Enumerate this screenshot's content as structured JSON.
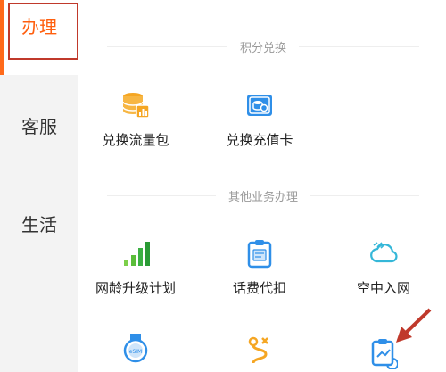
{
  "sidebar": {
    "items": [
      {
        "label": "办理",
        "active": true
      },
      {
        "label": "客服",
        "active": false
      },
      {
        "label": "生活",
        "active": false
      }
    ]
  },
  "sections": [
    {
      "title": "积分兑换",
      "tiles": [
        {
          "label": "兑换流量包",
          "icon": "data-package-icon"
        },
        {
          "label": "兑换充值卡",
          "icon": "recharge-card-icon"
        }
      ]
    },
    {
      "title": "其他业务办理",
      "tiles": [
        {
          "label": "网龄升级计划",
          "icon": "signal-bars-icon"
        },
        {
          "label": "话费代扣",
          "icon": "clipboard-bill-icon"
        },
        {
          "label": "空中入网",
          "icon": "cloud-network-icon"
        },
        {
          "label": "",
          "icon": "esim-watch-icon"
        },
        {
          "label": "",
          "icon": "route-icon"
        },
        {
          "label": "",
          "icon": "clipboard-chart-icon"
        }
      ]
    }
  ],
  "colors": {
    "accent": "#ff6a1a",
    "icon_blue": "#2f8fe8",
    "icon_orange": "#f5a623",
    "icon_green": "#3cb043",
    "annotation_red": "#c0392b"
  }
}
